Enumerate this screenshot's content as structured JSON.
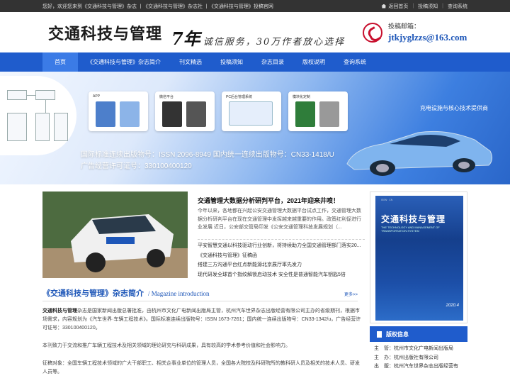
{
  "topbar": {
    "welcome": "您好，欢迎您来到《交通科技与管理》杂志 丨《交通科技与管理》杂志社 丨《交通科技与管理》投稿官网",
    "links": [
      "返回首页",
      "投稿须知",
      "查询系统"
    ]
  },
  "header": {
    "logo": "交通科技与管理",
    "slogan_big": "7年",
    "slogan_small": "诚信服务，30万作者放心选择",
    "contact_label": "投稿邮箱：",
    "contact_email": "jtkjyglzzs@163.com"
  },
  "nav": [
    "首页",
    "《交通科技与管理》杂志简介",
    "刊文精选",
    "投稿须知",
    "杂志目录",
    "版权说明",
    "查询系统"
  ],
  "banner": {
    "cards": [
      "APP",
      "微信平台",
      "PC后台管理系统",
      "模块化定制"
    ],
    "tagline": "充电设施与核心技术提供商",
    "info_line1": "国际标准连续出版物号：ISSN 2096-8949 国内统一连续出版物号：CN33-1418/U",
    "info_line2": "广告经营许可证号：330100400120"
  },
  "news": {
    "title": "交通管理大数据分析研判平台，2021年迎来井喷！",
    "body": "今年以来，各地都在兴起公安交通管理大数据平台试点工作，交通管理大数据分析研判平台在现在交通管理中发挥越来越重要的作用。政策红利促进行业发展 近日，公安部交管局印发《公安交通管理科技发展规划（...",
    "list": [
      "平安智慧交通以科技驱动行业创新，将持续助力全国交通管理部门落实20...",
      "《交通科技与管理》征稿函",
      "搭建三方沟通平台红点新能源北京展厅率先发力",
      "现代研发全球首个指纹解锁启动技术 安全性是普通智能汽车钥匙5倍"
    ]
  },
  "intro": {
    "title": "《交通科技与管理》杂志简介",
    "title_en": "/ Magazine introduction",
    "more": "更多>>",
    "p1_bold": "交通科技与管理",
    "p1": "杂志是国家新闻出版总署批准，由杭州市文化广电新闻出版局主管，杭州汽车世界杂志出版经营有限公司主办的省级期刊，根据市场需求，内容规划为《汽车世界·车辆工程技术》。国际标准连续出版物号：ISSN 1673-7261；国内统一连续出版物号：CN33-1342/u，广告经营许可证号：330100400120。",
    "p2": "本刊致力于交流和推广车辆工程技术及相关领域的理论研究与科研成果，具有较高的学术参考价值和社会影响力。",
    "p3": "征稿对象：全国车辆工程技术领域的广大干部职工、相关企事业单位的管理人员，全国各大院校及科研院所的教科研人员及相关的技术人员、研发人员等。"
  },
  "cover": {
    "title": "交通科技与管理",
    "subtitle": "THE TECHNOLOGY AND MANAGEMENT OF TRANSPORTATION SYSTEM",
    "year": "2020.4"
  },
  "publish": {
    "heading": "版权信息",
    "rows": [
      "主　管：杭州市文化广电新闻出版局",
      "主　办：杭州出版社有限公司",
      "出　版：杭州汽车世界杂志出版经营有"
    ]
  }
}
